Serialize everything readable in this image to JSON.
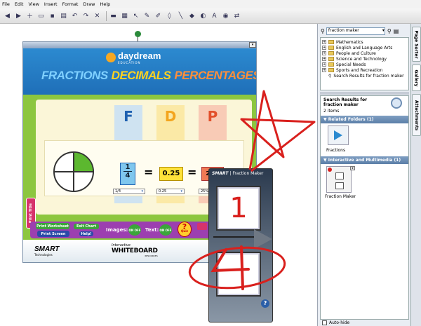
{
  "menu": [
    "File",
    "Edit",
    "View",
    "Insert",
    "Format",
    "Draw",
    "Help"
  ],
  "toolbar_icons": [
    "previous-page-icon",
    "next-page-icon",
    "add-page-icon",
    "open-icon",
    "save-icon",
    "paste-icon",
    "undo-icon",
    "redo-icon",
    "delete-icon",
    "screen-shade-icon",
    "table-icon",
    "select-icon",
    "pen-icon",
    "creative-pen-icon",
    "eraser-icon",
    "line-icon",
    "shape-icon",
    "fill-icon",
    "text-icon",
    "properties-icon",
    "move-toolbar-icon"
  ],
  "activity": {
    "brand": "daydream",
    "brand_sub": "EDUCATION",
    "title_fractions": "FRACTIONS",
    "title_decimals": "DECIMALS",
    "title_percentages": "PERCENTAGES",
    "col_f": "F",
    "col_d": "D",
    "col_p": "P",
    "numerator": "1",
    "denominator": "4",
    "eq1": "=",
    "eq2": "=",
    "decimal": "0.25",
    "percent": "25%",
    "select_f": "1/4",
    "select_d": "0.25",
    "select_p": "25%",
    "side_tab": "Print Title",
    "btn_print_ws": "Print Worksheet",
    "btn_exit": "Exit Chart",
    "btn_print_screen": "Print Screen",
    "btn_help": "Help!",
    "label_images": "Images:",
    "label_text": "Text:",
    "on_off": "ON OFF",
    "quiz": "Quiz",
    "smart": "SMART",
    "smart_sub": "Technologies",
    "wb_top": "Interactive",
    "wb_main": "WHITEBOARD",
    "wb_sub": "RESOURCES"
  },
  "fraction_maker": {
    "smart": "SMART",
    "title": "| Fraction Maker",
    "numerator": "1",
    "denominator": "4",
    "help": "?"
  },
  "gallery": {
    "search_value": "fraction maker",
    "tree": [
      "Mathematics",
      "English and Language Arts",
      "People and Culture",
      "Science and Technology",
      "Special Needs",
      "Sports and Recreation",
      "Search Results for fraction maker"
    ],
    "results_title": "Search Results for fraction maker",
    "results_count": "2 items",
    "related_header": "▼ Related Folders (1)",
    "folder_label": "Fractions",
    "interactive_header": "▼ Interactive and Multimedia (1)",
    "item_label": "Fraction Maker",
    "autohide": "Auto-hide"
  },
  "tabs": [
    "Page Sorter",
    "Gallery",
    "Attachments"
  ],
  "colors": {
    "annotation": "#d9201d",
    "header_blue": "#5b7fa8",
    "green_bg": "#8cc63f"
  }
}
